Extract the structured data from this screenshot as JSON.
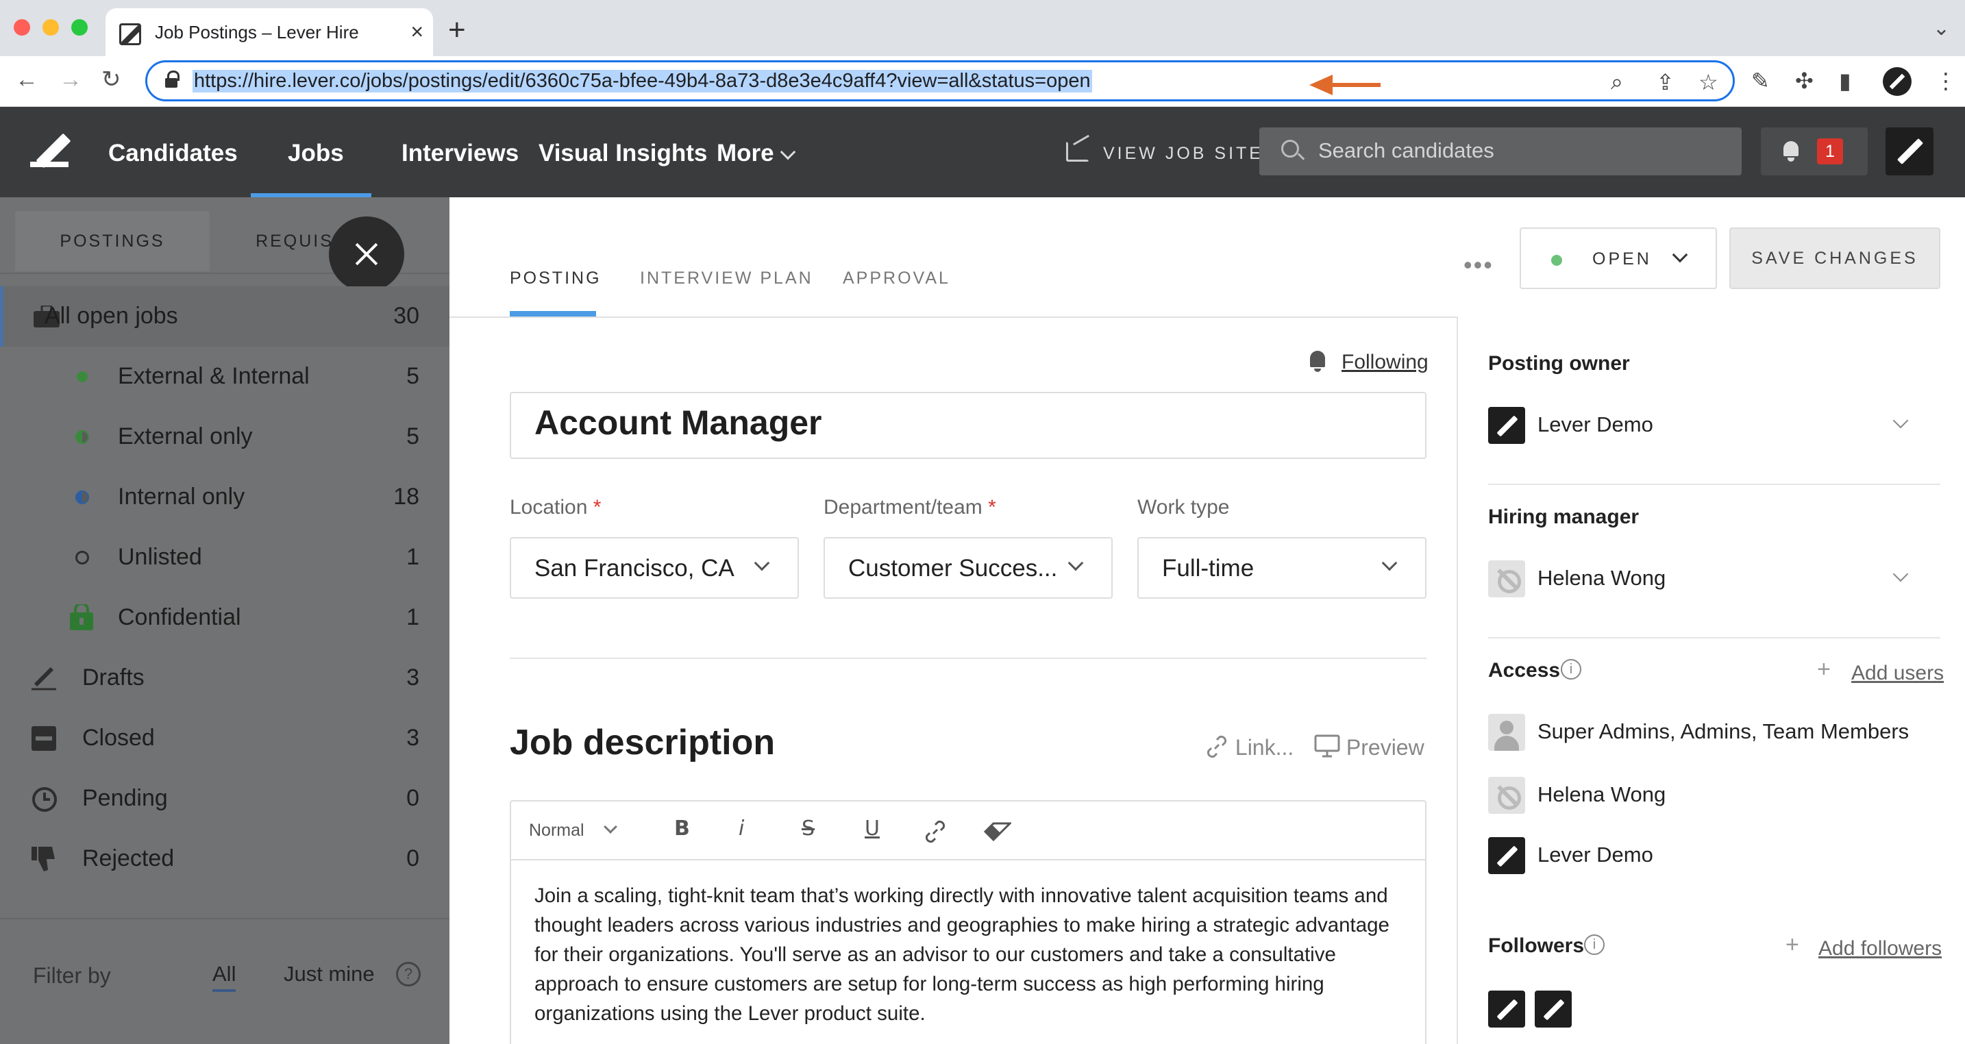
{
  "browser": {
    "tab_title": "Job Postings – Lever Hire",
    "url": "https://hire.lever.co/jobs/postings/edit/6360c75a-bfee-49b4-8a73-d8e3e4c9aff4?view=all&status=open",
    "annotation_arrow_color": "#e06a2c"
  },
  "header": {
    "nav": [
      "Candidates",
      "Jobs",
      "Interviews",
      "Visual Insights",
      "More"
    ],
    "active_nav": "Jobs",
    "view_job_site": "VIEW JOB SITE",
    "search_placeholder": "Search candidates",
    "notification_count": "1"
  },
  "sidebar": {
    "tabs": [
      "POSTINGS",
      "REQUIS"
    ],
    "items": [
      {
        "label": "All open jobs",
        "count": "30",
        "icon": "briefcase-icon"
      },
      {
        "label": "External & Internal",
        "count": "5",
        "icon": "green-dot-icon"
      },
      {
        "label": "External only",
        "count": "5",
        "icon": "half-green-dot-icon"
      },
      {
        "label": "Internal only",
        "count": "18",
        "icon": "half-blue-dot-icon"
      },
      {
        "label": "Unlisted",
        "count": "1",
        "icon": "hollow-dot-icon"
      },
      {
        "label": "Confidential",
        "count": "1",
        "icon": "lock-icon"
      },
      {
        "label": "Drafts",
        "count": "3",
        "icon": "pencil-icon"
      },
      {
        "label": "Closed",
        "count": "3",
        "icon": "closed-icon"
      },
      {
        "label": "Pending",
        "count": "0",
        "icon": "clock-icon"
      },
      {
        "label": "Rejected",
        "count": "0",
        "icon": "thumbs-down-icon"
      }
    ],
    "filter_by": "Filter by",
    "filter_all": "All",
    "filter_mine": "Just mine",
    "help": "?"
  },
  "main": {
    "tabs": [
      "POSTING",
      "INTERVIEW PLAN",
      "APPROVAL"
    ],
    "status": "OPEN",
    "save": "SAVE CHANGES",
    "following": "Following",
    "title": "Account Manager",
    "location_label": "Location",
    "location_value": "San Francisco, CA",
    "department_label": "Department/team",
    "department_value": "Customer Succes...",
    "worktype_label": "Work type",
    "worktype_value": "Full-time",
    "required_mark": "*",
    "job_description_title": "Job description",
    "link_label": "Link...",
    "preview_label": "Preview",
    "editor_format": "Normal",
    "editor_text": "Join a scaling, tight-knit team that’s working directly with innovative talent acquisition teams and thought leaders across various industries and geographies to make hiring a strategic advantage for their organizations. You'll serve as an advisor to our customers and take a consultative approach to ensure customers are setup for long-term success as high performing hiring organizations using the Lever product suite."
  },
  "right_panel": {
    "posting_owner_label": "Posting owner",
    "posting_owner": "Lever Demo",
    "hiring_manager_label": "Hiring manager",
    "hiring_manager": "Helena Wong",
    "access_label": "Access",
    "add_users": "Add users",
    "access_list": [
      "Super Admins, Admins, Team Members",
      "Helena Wong",
      "Lever Demo"
    ],
    "followers_label": "Followers",
    "add_followers": "Add followers"
  }
}
